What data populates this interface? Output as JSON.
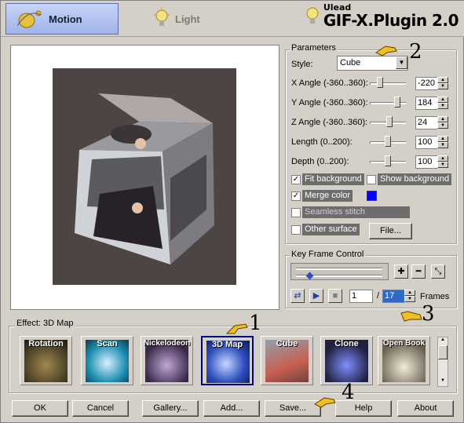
{
  "header": {
    "tabs": [
      {
        "label": "Motion",
        "active": true
      },
      {
        "label": "Light",
        "active": false
      }
    ],
    "brand_small": "Ulead",
    "brand_big": "GIF-X.Plugin 2.0"
  },
  "parameters": {
    "group_label": "Parameters",
    "style_label": "Style:",
    "style_value": "Cube",
    "rows": [
      {
        "label": "X Angle (-360..360):",
        "value": "-220",
        "level": 0.195
      },
      {
        "label": "Y Angle (-360..360):",
        "value": "184",
        "level": 0.755
      },
      {
        "label": "Z Angle (-360..360):",
        "value": "24",
        "level": 0.533
      },
      {
        "label": "Length (0..200):",
        "value": "100",
        "level": 0.5
      },
      {
        "label": "Depth (0..200):",
        "value": "100",
        "level": 0.5
      }
    ],
    "fit_background": {
      "label": "Fit background",
      "checked": true
    },
    "show_background": {
      "label": "Show background",
      "checked": false
    },
    "merge_color": {
      "label": "Merge color",
      "checked": true,
      "color": "#0000ff"
    },
    "seamless_stitch": {
      "label": "Seamless stitch",
      "checked": false
    },
    "other_surface": {
      "label": "Other surface",
      "checked": false
    },
    "file_button": "File..."
  },
  "keyframe": {
    "group_label": "Key Frame Control",
    "frame_current": "1",
    "separator": "/",
    "frame_total": "17",
    "frames_label": "Frames"
  },
  "effects": {
    "group_label": "Effect: 3D Map",
    "items": [
      {
        "label": "Rotation",
        "selected": false
      },
      {
        "label": "Scan",
        "selected": false
      },
      {
        "label": "Nickelodeon",
        "selected": false
      },
      {
        "label": "3D Map",
        "selected": true
      },
      {
        "label": "Cube",
        "selected": false
      },
      {
        "label": "Clone",
        "selected": false
      },
      {
        "label": "Open Book",
        "selected": false
      }
    ]
  },
  "buttons": {
    "ok": "OK",
    "cancel": "Cancel",
    "gallery": "Gallery...",
    "add": "Add...",
    "save": "Save...",
    "help": "Help",
    "about": "About"
  },
  "callouts": {
    "one": "1",
    "two": "2",
    "three": "3",
    "four": "4"
  },
  "colors": {
    "merge_swatch": "#0000ff",
    "selected_border": "#000080"
  }
}
